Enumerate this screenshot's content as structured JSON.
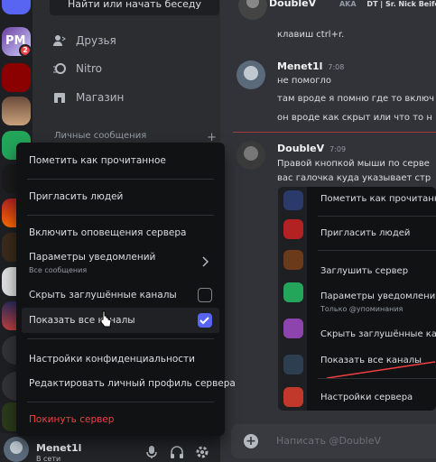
{
  "search": {
    "label": "Найти или начать беседу"
  },
  "nav": {
    "friends": "Друзья",
    "nitro": "Nitro",
    "shop": "Магазин"
  },
  "dm_header": {
    "label": "Личные сообщения",
    "add": "+"
  },
  "rail": {
    "badge_count": "2",
    "pm_label": "PM"
  },
  "messages": {
    "top_author": "DoubleV",
    "top_aka": "AKA",
    "top_tag": "DT | Sr. Nick Beife",
    "top_text": "клавиш ctrl+r.",
    "m1_author": "Menet1l",
    "m1_time": "7:08",
    "m1_line1": "не помогло",
    "m1_line2": "там вроде я помню где то включ",
    "m1_line3": "он вроде как скрыт или что то н",
    "m2_author": "DoubleV",
    "m2_time": "7:09",
    "m2_line1": "Правой кнопкой мыши по серве",
    "m2_line2": "вас галочка куда указывает стр"
  },
  "embed": {
    "items": [
      "Пометить как прочитанное",
      "Пригласить людей",
      "Заглушить сервер",
      "Параметры уведомлений",
      "Скрыть заглушённые кана",
      "Показать все каналы",
      "Настройки сервера"
    ],
    "notif_sub": "Только @упоминания"
  },
  "composer": {
    "placeholder": "Написать @DoubleV"
  },
  "user": {
    "name": "Menet1l",
    "status": "В сети"
  },
  "menu": {
    "mark_read": "Пометить как прочитанное",
    "invite": "Пригласить людей",
    "enable_notifications": "Включить оповещения сервера",
    "notif_settings": "Параметры уведомлений",
    "notif_settings_sub": "Все сообщения",
    "hide_muted": "Скрыть заглушённые каналы",
    "show_all": "Показать все каналы",
    "privacy": "Настройки конфиденциальности",
    "edit_profile": "Редактировать личный профиль сервера",
    "leave": "Покинуть сервер",
    "hide_muted_checked": false,
    "show_all_checked": true
  },
  "colors": {
    "accent": "#5865f2",
    "danger": "#f23f43",
    "online": "#23a55a"
  }
}
